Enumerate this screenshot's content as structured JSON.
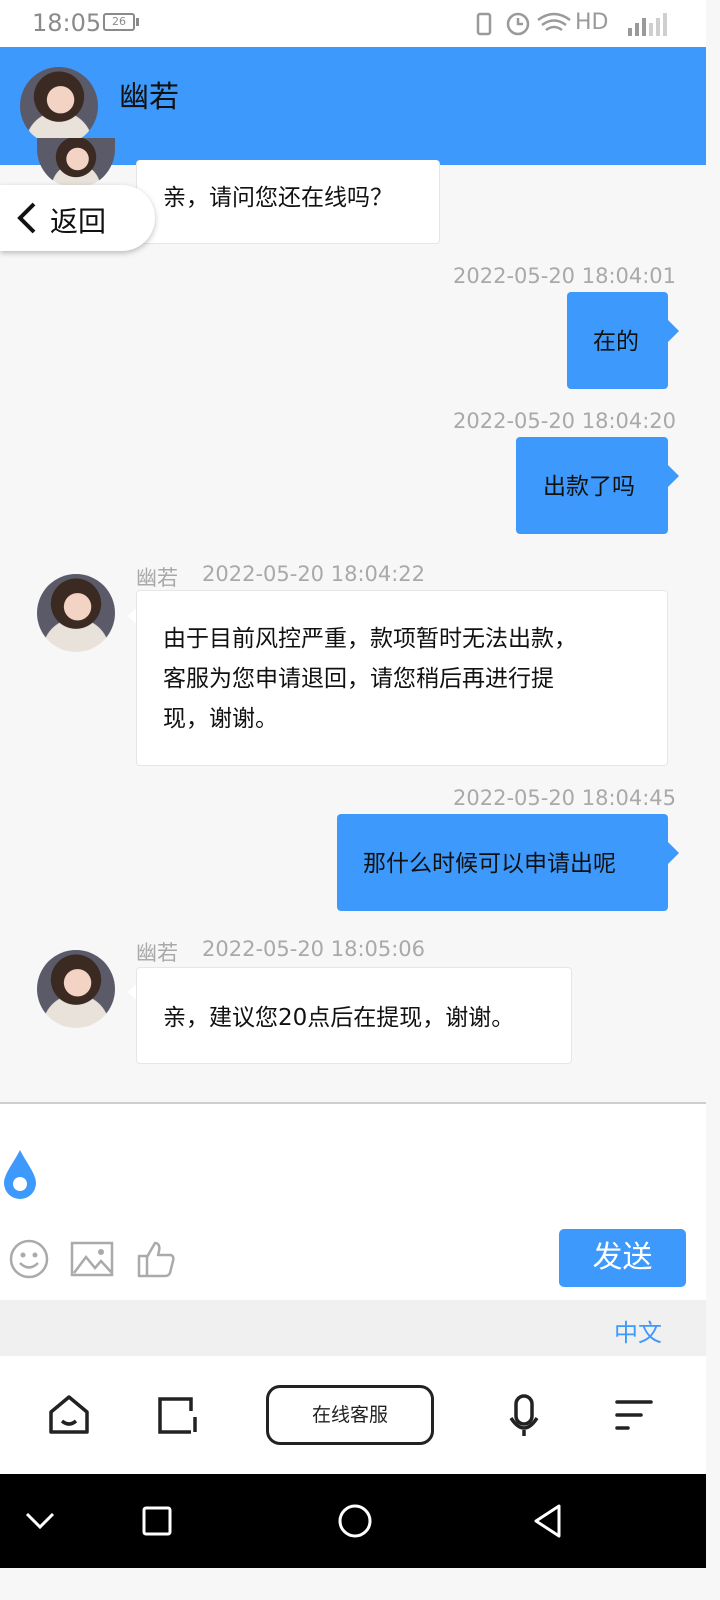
{
  "status_bar": {
    "time": "18:05",
    "battery": "26",
    "right": "HD"
  },
  "header": {
    "title": "幽若"
  },
  "back": {
    "label": "返回"
  },
  "messages": [
    {
      "side": "in",
      "text": "亲，请问您还在线吗？"
    },
    {
      "side": "out",
      "time": "2022-05-20 18:04:01",
      "text": "在的"
    },
    {
      "side": "out",
      "time": "2022-05-20 18:04:20",
      "text": "出款了吗"
    },
    {
      "side": "in",
      "sender": "幽若",
      "time": "2022-05-20 18:04:22",
      "lines": [
        "由于目前风控严重，款项暂时无法出款，",
        "客服为您申请退回，请您稍后再进行提",
        "现，谢谢。"
      ]
    },
    {
      "side": "out",
      "time": "2022-05-20 18:04:45",
      "text": "那什么时候可以申请出呢"
    },
    {
      "side": "in",
      "sender": "幽若",
      "time": "2022-05-20 18:05:06",
      "text": "亲，建议您20点后在提现，谢谢。"
    }
  ],
  "composer": {
    "send_label": "发送",
    "language_label": "中文",
    "icons": [
      "emoji-icon",
      "image-icon",
      "thumbs-up-icon"
    ]
  },
  "toolbar": {
    "online_service_label": "在线客服",
    "icons": [
      "home-icon",
      "tabs-icon",
      "microphone-icon",
      "menu-icon"
    ]
  },
  "colors": {
    "accent": "#3d9afc",
    "bubble_in": "#ffffff",
    "background": "#f7f7f7"
  }
}
